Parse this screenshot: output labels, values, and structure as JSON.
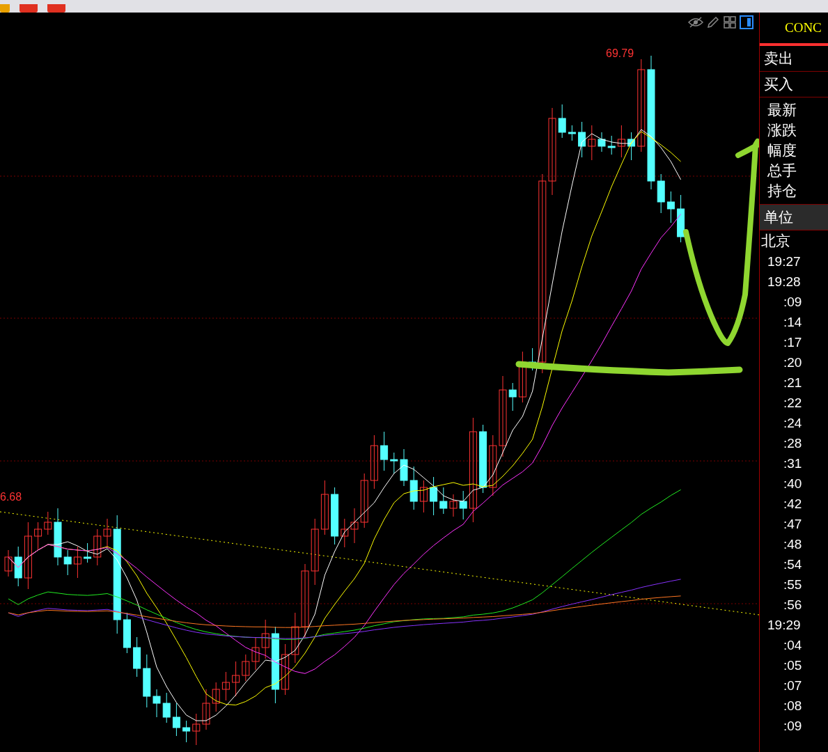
{
  "chart": {
    "high_label": "69.79",
    "left_label": "6.68"
  },
  "side_panel": {
    "title": "CONC",
    "rows": [
      {
        "labels": [
          "卖出"
        ],
        "selected": false
      },
      {
        "labels": [
          "买入"
        ],
        "selected": false
      },
      {
        "labels": [
          "最新",
          "涨跌",
          "幅度",
          "总手",
          "持仓"
        ],
        "selected": false
      },
      {
        "labels": [
          "单位"
        ],
        "selected": true
      }
    ],
    "zone": "北京",
    "times": [
      {
        "text": "19:27",
        "kind": "hour"
      },
      {
        "text": "19:28",
        "kind": "hour"
      },
      {
        "text": ":09",
        "kind": "minute"
      },
      {
        "text": ":14",
        "kind": "minute"
      },
      {
        "text": ":17",
        "kind": "minute"
      },
      {
        "text": ":20",
        "kind": "minute"
      },
      {
        "text": ":21",
        "kind": "minute"
      },
      {
        "text": ":22",
        "kind": "minute"
      },
      {
        "text": ":24",
        "kind": "minute"
      },
      {
        "text": ":28",
        "kind": "minute"
      },
      {
        "text": ":31",
        "kind": "minute"
      },
      {
        "text": ":40",
        "kind": "minute"
      },
      {
        "text": ":42",
        "kind": "minute"
      },
      {
        "text": ":47",
        "kind": "minute"
      },
      {
        "text": ":48",
        "kind": "minute"
      },
      {
        "text": ":54",
        "kind": "minute"
      },
      {
        "text": ":55",
        "kind": "minute"
      },
      {
        "text": ":56",
        "kind": "minute"
      },
      {
        "text": "19:29",
        "kind": "hour"
      },
      {
        "text": ":04",
        "kind": "minute"
      },
      {
        "text": ":05",
        "kind": "minute"
      },
      {
        "text": ":07",
        "kind": "minute"
      },
      {
        "text": ":08",
        "kind": "minute"
      },
      {
        "text": ":09",
        "kind": "minute"
      }
    ]
  }
}
